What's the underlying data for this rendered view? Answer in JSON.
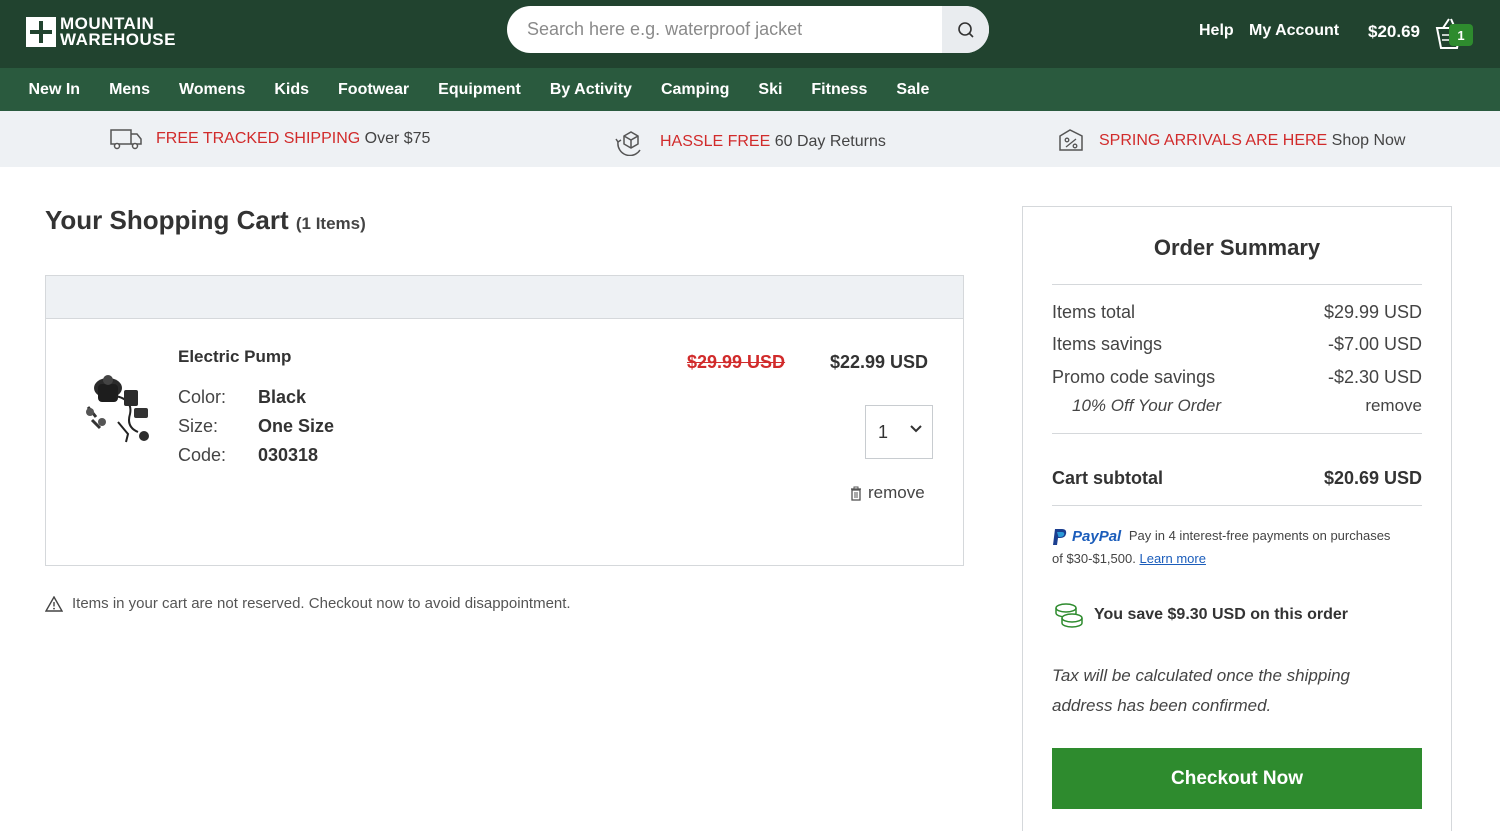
{
  "header": {
    "logo_line1": "MOUNTAIN",
    "logo_line2": "WAREHOUSE",
    "search_placeholder": "Search here e.g. waterproof jacket",
    "help_label": "Help",
    "account_label": "My Account",
    "cart_total": "$20.69",
    "cart_count": "1"
  },
  "nav": {
    "items": [
      "New In",
      "Mens",
      "Womens",
      "Kids",
      "Footwear",
      "Equipment",
      "By Activity",
      "Camping",
      "Ski",
      "Fitness",
      "Sale"
    ]
  },
  "usp": [
    {
      "highlight": "FREE TRACKED SHIPPING",
      "rest": " Over $75",
      "icon": "truck-icon"
    },
    {
      "highlight": "HASSLE FREE",
      "rest": " 60 Day Returns",
      "icon": "return-box-icon"
    },
    {
      "highlight": "SPRING ARRIVALS ARE HERE",
      "rest": " Shop Now",
      "icon": "discount-tag-icon"
    }
  ],
  "cart": {
    "title": "Your Shopping Cart",
    "count_label": "(1 Items)",
    "item": {
      "name": "Electric Pump",
      "color_label": "Color:",
      "color_value": "Black",
      "size_label": "Size:",
      "size_value": "One Size",
      "code_label": "Code:",
      "code_value": "030318",
      "old_price": "$29.99 USD",
      "new_price": "$22.99 USD",
      "quantity": "1",
      "remove_label": "remove"
    },
    "warning": "Items in your cart are not reserved. Checkout now to avoid disappointment."
  },
  "summary": {
    "title": "Order Summary",
    "items_total_label": "Items total",
    "items_total_value": "$29.99 USD",
    "items_savings_label": "Items savings",
    "items_savings_value": "-$7.00 USD",
    "promo_label": "Promo code savings",
    "promo_value": "-$2.30 USD",
    "promo_name": "10% Off Your Order",
    "promo_remove": "remove",
    "subtotal_label": "Cart subtotal",
    "subtotal_value": "$20.69 USD",
    "paypal_brand": "PayPal",
    "paypal_text": "Pay in 4 interest-free payments on purchases of $30-$1,500.",
    "paypal_link": "Learn more",
    "savings_text": "You save $9.30 USD on this order",
    "tax_note": "Tax will be calculated once the shipping address has been confirmed.",
    "checkout_label": "Checkout Now"
  },
  "colors": {
    "header_bg": "#21432f",
    "nav_bg": "#2a5a3e",
    "accent_red": "#d12b2b",
    "checkout_green": "#2e8b2e",
    "paypal_blue": "#1b5dbb"
  }
}
